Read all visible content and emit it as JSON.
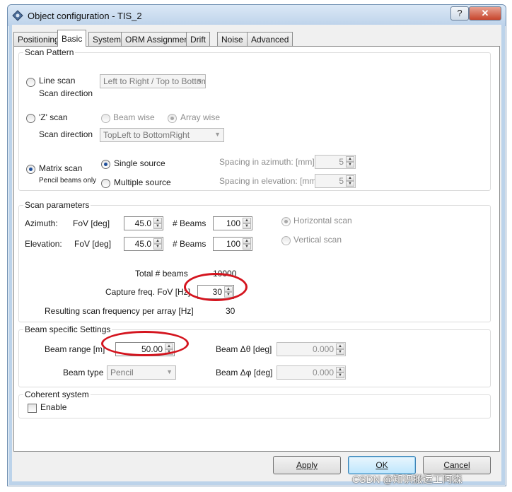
{
  "window": {
    "title": "Object configuration - TIS_2",
    "help_label": "?",
    "close_label": "✕"
  },
  "tabs": [
    "Positioning",
    "Basic",
    "System",
    "ORM Assignment",
    "Drift",
    "Noise",
    "Advanced"
  ],
  "scan_pattern": {
    "title": "Scan Pattern",
    "line_scan": {
      "label": "Line scan",
      "direction_label": "Scan direction",
      "direction_value": "Left to Right / Top to Bottom"
    },
    "z_scan": {
      "label": "'Z' scan",
      "beam_wise": "Beam wise",
      "array_wise": "Array wise",
      "direction_label": "Scan direction",
      "direction_value": "TopLeft to BottomRight"
    },
    "matrix_scan": {
      "label": "Matrix scan",
      "note": "Pencil beams only",
      "single_source": "Single source",
      "multiple_source": "Multiple source",
      "spacing_azimuth_label": "Spacing in azimuth:  [mm]",
      "spacing_azimuth_value": "5",
      "spacing_elevation_label": "Spacing in elevation: [mm]",
      "spacing_elevation_value": "5"
    }
  },
  "scan_parameters": {
    "title": "Scan parameters",
    "azimuth_label": "Azimuth:",
    "elevation_label": "Elevation:",
    "fov_label": "FoV [deg]",
    "beams_label": "# Beams",
    "azimuth_fov": "45.0",
    "azimuth_beams": "100",
    "elevation_fov": "45.0",
    "elevation_beams": "100",
    "horizontal_scan": "Horizontal scan",
    "vertical_scan": "Vertical scan",
    "total_beams_label": "Total # beams",
    "total_beams_value": "10000",
    "capture_freq_label": "Capture freq. FoV [Hz]",
    "capture_freq_value": "30",
    "resulting_freq_label": "Resulting scan frequency per array [Hz]",
    "resulting_freq_value": "30"
  },
  "beam_settings": {
    "title": "Beam specific Settings",
    "range_label": "Beam range [m]",
    "range_value": "50.00",
    "type_label": "Beam type",
    "type_value": "Pencil",
    "delta_theta_label": "Beam  Δθ [deg]",
    "delta_theta_value": "0.000",
    "delta_phi_label": "Beam  Δφ [deg]",
    "delta_phi_value": "0.000"
  },
  "coherent": {
    "title": "Coherent system",
    "enable_label": "Enable"
  },
  "buttons": {
    "apply": "Apply",
    "ok": "OK",
    "cancel": "Cancel"
  },
  "watermark": "CSDN @知识搬运工阿森",
  "colors": {
    "annotation_ring": "#d4141e",
    "title_bar": "#bcd2ea"
  }
}
